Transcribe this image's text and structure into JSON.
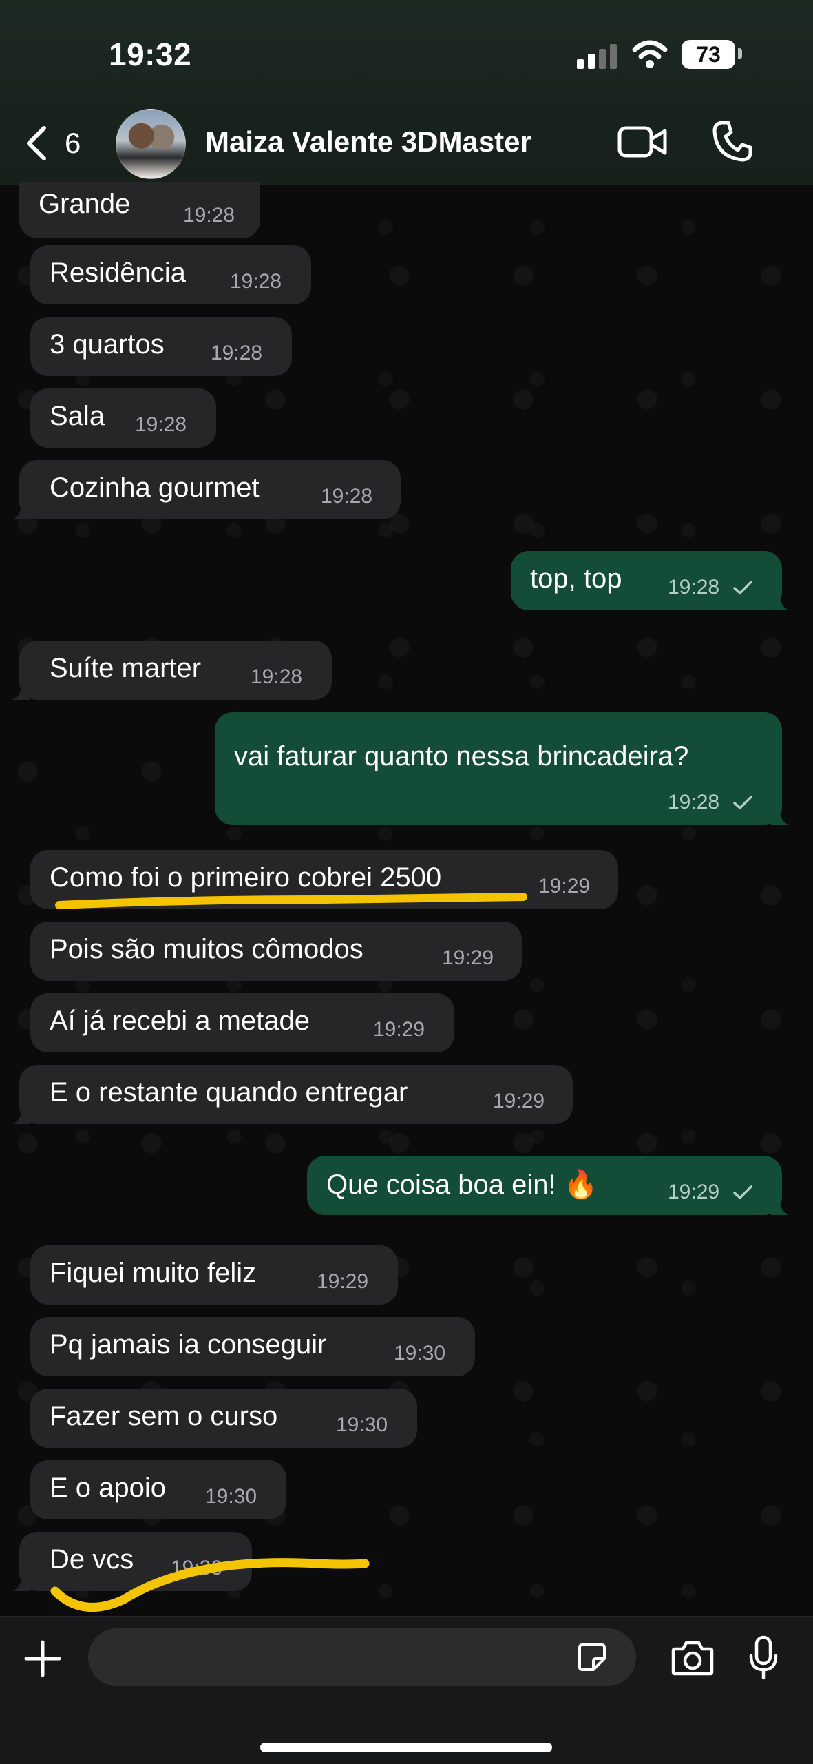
{
  "status_bar": {
    "time": "19:32",
    "battery": "73"
  },
  "header": {
    "back_count": "6",
    "contact_name": "Maiza Valente 3DMaster"
  },
  "messages": [
    {
      "text": "Grande",
      "time": "19:28"
    },
    {
      "text": "Residência",
      "time": "19:28"
    },
    {
      "text": "3 quartos",
      "time": "19:28"
    },
    {
      "text": "Sala",
      "time": "19:28"
    },
    {
      "text": "Cozinha gourmet",
      "time": "19:28"
    },
    {
      "text": "top, top",
      "time": "19:28"
    },
    {
      "text": "Suíte marter",
      "time": "19:28"
    },
    {
      "text": "vai faturar quanto nessa brincadeira?",
      "time": "19:28"
    },
    {
      "text": "Como foi o primeiro cobrei 2500",
      "time": "19:29"
    },
    {
      "text": "Pois são muitos cômodos",
      "time": "19:29"
    },
    {
      "text": "Aí já recebi a metade",
      "time": "19:29"
    },
    {
      "text": "E o restante quando entregar",
      "time": "19:29"
    },
    {
      "text": "Que coisa boa ein! 🔥",
      "time": "19:29"
    },
    {
      "text": "Fiquei muito feliz",
      "time": "19:29"
    },
    {
      "text": "Pq jamais ia conseguir",
      "time": "19:30"
    },
    {
      "text": "Fazer sem o curso",
      "time": "19:30"
    },
    {
      "text": "E o apoio",
      "time": "19:30"
    },
    {
      "text": "De vcs",
      "time": "19:30"
    }
  ],
  "composer": {
    "placeholder": ""
  },
  "icons": {
    "back": "chevron-left-icon",
    "video": "video-camera-icon",
    "phone": "phone-icon",
    "plus": "plus-icon",
    "sticker": "sticker-icon",
    "camera": "camera-icon",
    "mic": "microphone-icon",
    "read": "checkmark-icon"
  },
  "colors": {
    "incoming_bubble": "#262628",
    "outgoing_bubble": "#144d37",
    "header_bg": "#1d2a22",
    "highlight": "#f5c400"
  }
}
